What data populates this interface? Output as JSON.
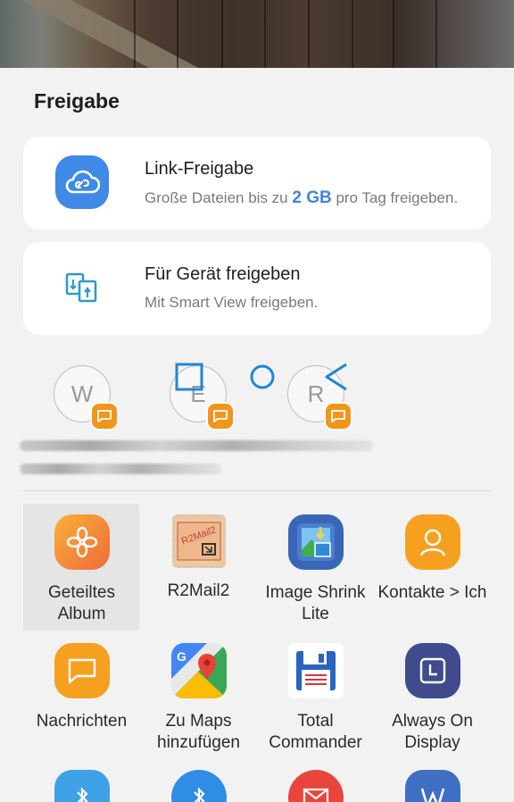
{
  "sheet": {
    "title": "Freigabe"
  },
  "link_share": {
    "title": "Link-Freigabe",
    "subtitle_prefix": "Große Dateien bis zu ",
    "subtitle_bold": "2 GB",
    "subtitle_suffix": " pro Tag freigeben.",
    "icon": "cloud-link-icon"
  },
  "device_share": {
    "title": "Für Gerät freigeben",
    "subtitle": "Mit Smart View freigeben.",
    "icon": "smart-view-icon"
  },
  "recent_contacts": [
    {
      "initial": "W"
    },
    {
      "initial": "E"
    },
    {
      "initial": "R"
    }
  ],
  "apps_row1": [
    {
      "label": "Geteiltes Album",
      "icon": "shared-album-icon"
    },
    {
      "label": "R2Mail2",
      "icon": "r2mail2-icon"
    },
    {
      "label": "Image Shrink Lite",
      "icon": "image-shrink-icon"
    },
    {
      "label": "Kontakte > Ich",
      "icon": "contact-me-icon"
    }
  ],
  "apps_row2": [
    {
      "label": "Nachrichten",
      "icon": "messages-icon"
    },
    {
      "label": "Zu Maps hinzufügen",
      "icon": "google-maps-icon"
    },
    {
      "label": "Total Commander",
      "icon": "total-commander-icon"
    },
    {
      "label": "Always On Display",
      "icon": "always-on-display-icon"
    }
  ],
  "r2mail_icon_text": "R2Mail2",
  "colors": {
    "accent_blue": "#3f8ae6",
    "orange": "#f1961b",
    "background": "#f2f2f2"
  }
}
